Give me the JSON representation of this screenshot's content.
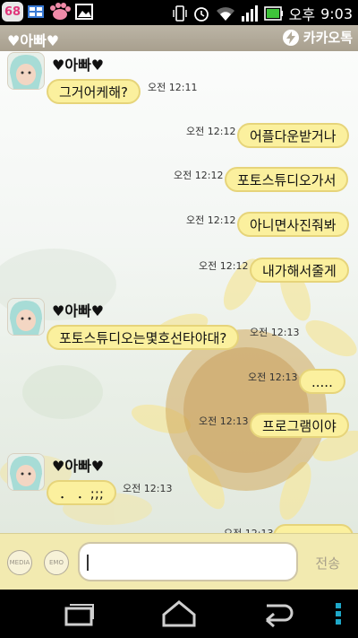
{
  "status_bar": {
    "notification_count": "68",
    "ampm": "오후",
    "time": "9:03",
    "icons": [
      "paw-icon",
      "gallery-icon",
      "vibrate-icon",
      "alarm-icon",
      "wifi-icon",
      "signal-icon",
      "battery-icon"
    ]
  },
  "header": {
    "title": "♥아빠♥",
    "brand": "카카오톡"
  },
  "messages": [
    {
      "sender": "♥아빠♥",
      "text": "그거어케해?",
      "time": "오전 12:11",
      "side": "left"
    },
    {
      "text": "어플다운받거나",
      "time": "오전 12:12",
      "side": "right"
    },
    {
      "text": "포토스튜디오가서",
      "time": "오전 12:12",
      "side": "right"
    },
    {
      "text": "아니면사진줘봐",
      "time": "오전 12:12",
      "side": "right"
    },
    {
      "text": "내가해서줄게",
      "time": "오전 12:12",
      "side": "right"
    },
    {
      "sender": "♥아빠♥",
      "text": "포토스튜디오는몇호선타야대?",
      "time": "오전 12:13",
      "side": "left"
    },
    {
      "text": ".....",
      "time": "오전 12:13",
      "side": "right"
    },
    {
      "text": "프로그램이야",
      "time": "오전 12:13",
      "side": "right"
    },
    {
      "sender": "♥아빠♥",
      "text": "． ．;;;",
      "time": "오전 12:13",
      "side": "left"
    },
    {
      "text": "",
      "time": "오전 12:13",
      "side": "right"
    }
  ],
  "input": {
    "media_label": "MEDIA",
    "emo_label": "EMO",
    "value": "",
    "send_label": "전송"
  },
  "nav": [
    "recent-apps-icon",
    "home-icon",
    "back-icon",
    "menu-icon"
  ],
  "colors": {
    "bubble": "#fbf09e",
    "bubble_border": "#e6d47a",
    "title_bar": "#b3ab9a",
    "input_bar": "#f2eab0"
  }
}
